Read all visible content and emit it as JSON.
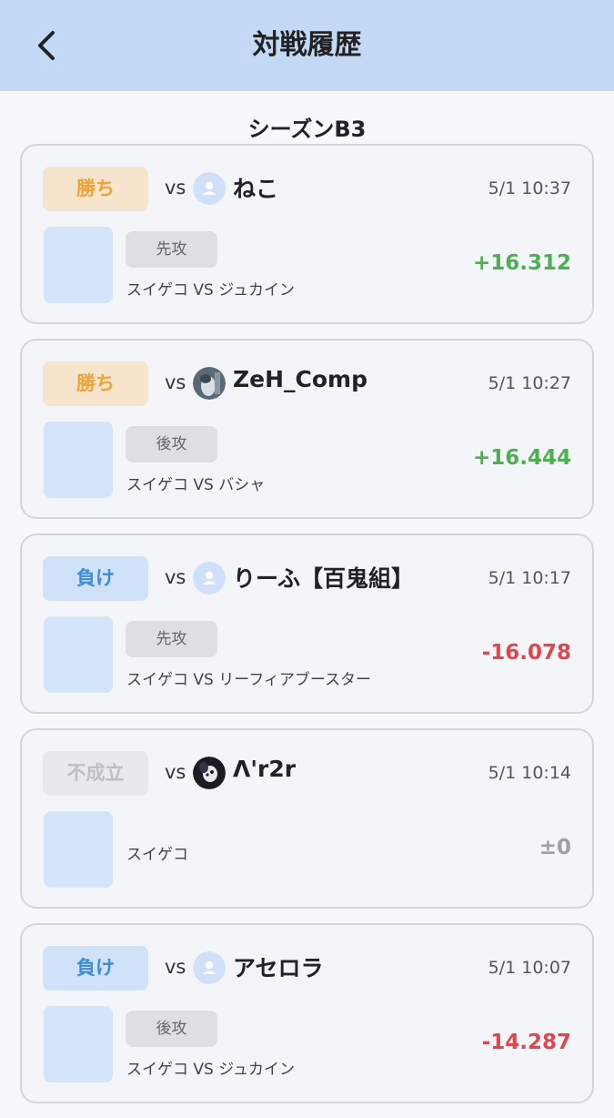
{
  "header": {
    "title": "対戦履歴",
    "back_icon": "chevron-left-icon"
  },
  "season": "シーズンB3",
  "vs_text": "vs",
  "colors": {
    "header_bg": "#c4d9f5",
    "win": "#f0a334",
    "lose": "#3b8ede",
    "plus": "#4caf50",
    "minus": "#e0464b"
  },
  "matches": [
    {
      "result": "勝ち",
      "result_type": "win",
      "opponent": "ねこ",
      "avatar": "default-user-icon",
      "time": "5/1 10:37",
      "turn": "先攻",
      "matchup": "スイゲコ VS ジュカイン",
      "rate": "+16.312",
      "rate_type": "plus"
    },
    {
      "result": "勝ち",
      "result_type": "win",
      "opponent": "ZeH_Comp",
      "avatar": "photo-avatar-icon",
      "time": "5/1 10:27",
      "turn": "後攻",
      "matchup": "スイゲコ VS バシャ",
      "rate": "+16.444",
      "rate_type": "plus"
    },
    {
      "result": "負け",
      "result_type": "lose",
      "opponent": "りーふ【百鬼組】",
      "avatar": "default-user-icon",
      "time": "5/1 10:17",
      "turn": "先攻",
      "matchup": "スイゲコ VS リーフィアブースター",
      "rate": "-16.078",
      "rate_type": "minus"
    },
    {
      "result": "不成立",
      "result_type": "void",
      "opponent": "Λ'r2r",
      "avatar": "photo-avatar-icon",
      "time": "5/1 10:14",
      "turn": "",
      "matchup": "スイゲコ",
      "rate": "±0",
      "rate_type": "zero"
    },
    {
      "result": "負け",
      "result_type": "lose",
      "opponent": "アセロラ",
      "avatar": "default-user-icon",
      "time": "5/1 10:07",
      "turn": "後攻",
      "matchup": "スイゲコ VS ジュカイン",
      "rate": "-14.287",
      "rate_type": "minus"
    }
  ]
}
